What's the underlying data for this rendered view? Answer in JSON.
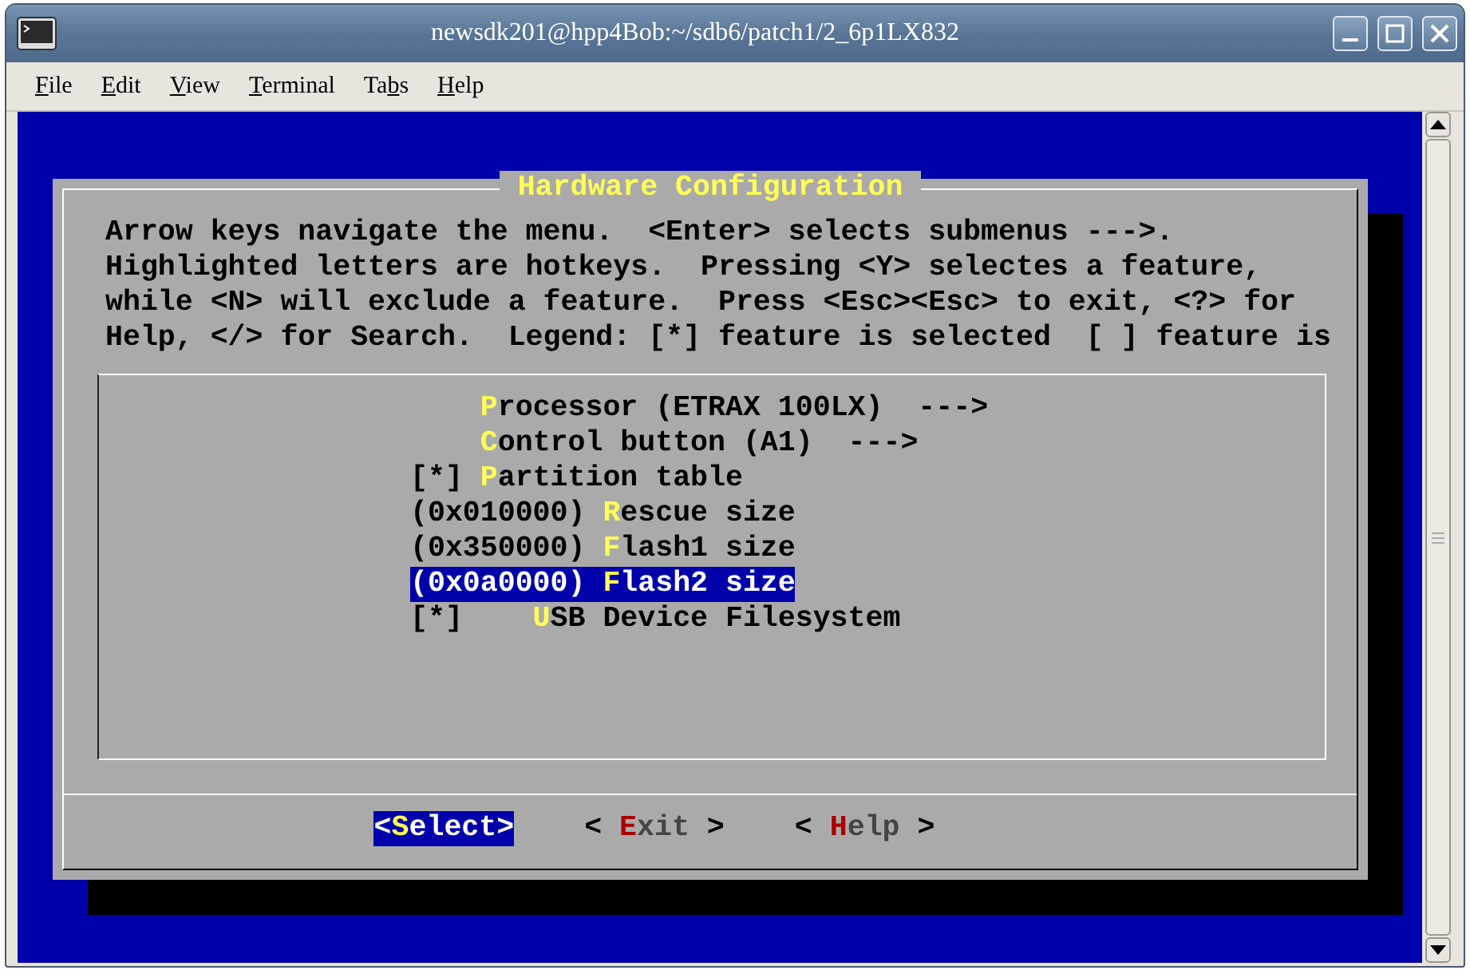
{
  "window": {
    "title": "newsdk201@hpp4Bob:~/sdb6/patch1/2_6p1LX832"
  },
  "menubar": [
    {
      "key": "F",
      "after": "ile"
    },
    {
      "key": "E",
      "after": "dit"
    },
    {
      "key": "V",
      "after": "iew"
    },
    {
      "key": "T",
      "after": "erminal"
    },
    {
      "before": "Ta",
      "key": "b",
      "after": "s"
    },
    {
      "key": "H",
      "after": "elp"
    }
  ],
  "dialog": {
    "title": "Hardware Configuration",
    "help_lines": [
      "Arrow keys navigate the menu.  <Enter> selects submenus --->.",
      "Highlighted letters are hotkeys.  Pressing <Y> selectes a feature,",
      "while <N> will exclude a feature.  Press <Esc><Esc> to exit, <?> for",
      "Help, </> for Search.  Legend: [*] feature is selected  [ ] feature is"
    ],
    "items": [
      {
        "kind": "menu",
        "name": "Processor (ETRAX 100LX)  --->",
        "selected": false
      },
      {
        "kind": "menu",
        "name": "Control button (A1)  --->",
        "selected": false
      },
      {
        "kind": "option",
        "prefix": "[*]",
        "name": "Partition table",
        "selected": false
      },
      {
        "kind": "option",
        "prefix": "(0x010000)",
        "name": "Rescue size",
        "selected": false
      },
      {
        "kind": "option",
        "prefix": "(0x350000)",
        "name": "Flash1 size",
        "selected": false
      },
      {
        "kind": "option",
        "prefix": "(0x0a0000)",
        "name": "Flash2 size",
        "selected": true
      },
      {
        "kind": "suboption",
        "prefix": "[*]",
        "name": "USB Device Filesystem",
        "selected": false
      }
    ],
    "buttons": [
      {
        "text": "<Select>",
        "selected": true
      },
      {
        "text": "< Exit >",
        "selected": false
      },
      {
        "text": "< Help >",
        "selected": false
      }
    ]
  }
}
